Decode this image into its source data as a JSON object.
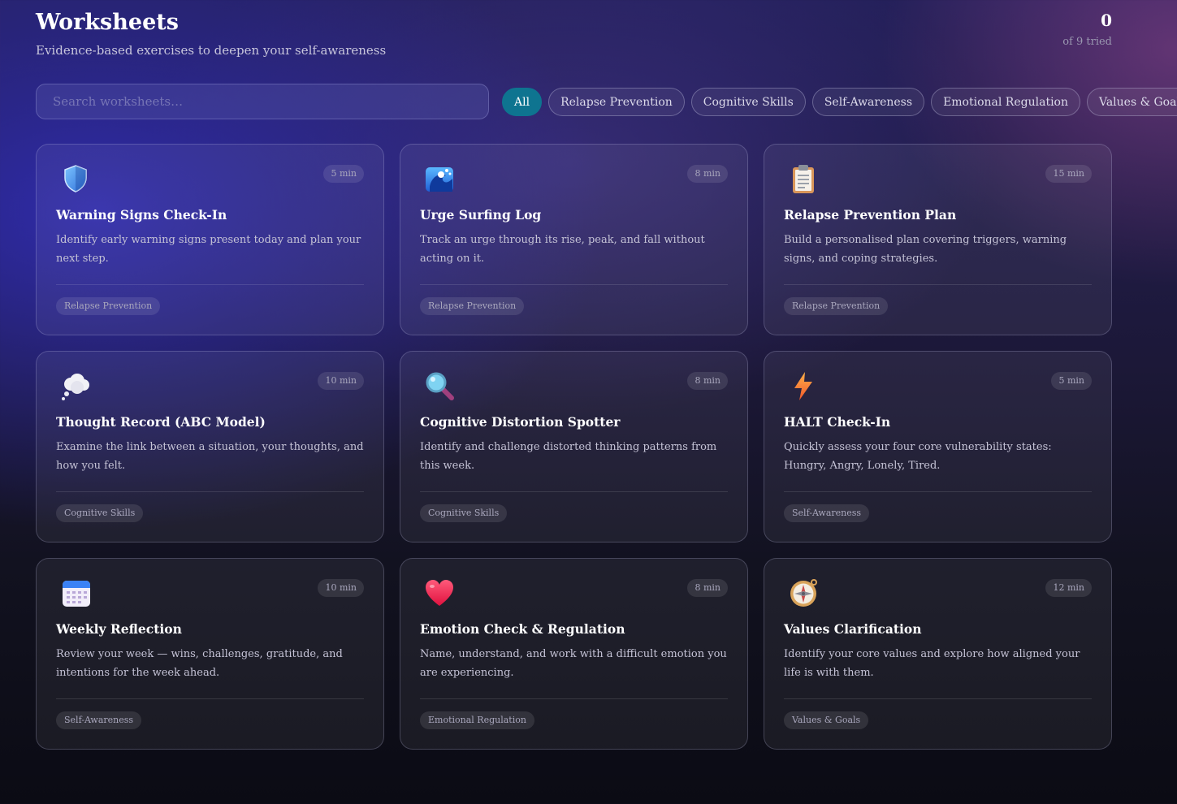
{
  "header": {
    "title": "Worksheets",
    "subtitle": "Evidence-based exercises to deepen your self-awareness",
    "count": "0",
    "count_label": "of 9 tried"
  },
  "search": {
    "placeholder": "Search worksheets…",
    "value": ""
  },
  "filters": [
    {
      "label": "All",
      "active": true
    },
    {
      "label": "Relapse Prevention",
      "active": false
    },
    {
      "label": "Cognitive Skills",
      "active": false
    },
    {
      "label": "Self-Awareness",
      "active": false
    },
    {
      "label": "Emotional Regulation",
      "active": false
    },
    {
      "label": "Values & Goals",
      "active": false
    }
  ],
  "cards": [
    {
      "icon": "shield-icon",
      "duration": "5 min",
      "title": "Warning Signs Check-In",
      "description": "Identify early warning signs present today and plan your next step.",
      "tag": "Relapse Prevention"
    },
    {
      "icon": "wave-icon",
      "duration": "8 min",
      "title": "Urge Surfing Log",
      "description": "Track an urge through its rise, peak, and fall without acting on it.",
      "tag": "Relapse Prevention"
    },
    {
      "icon": "clipboard-icon",
      "duration": "15 min",
      "title": "Relapse Prevention Plan",
      "description": "Build a personalised plan covering triggers, warning signs, and coping strategies.",
      "tag": "Relapse Prevention"
    },
    {
      "icon": "thought-bubble-icon",
      "duration": "10 min",
      "title": "Thought Record (ABC Model)",
      "description": "Examine the link between a situation, your thoughts, and how you felt.",
      "tag": "Cognitive Skills"
    },
    {
      "icon": "magnifying-glass-icon",
      "duration": "8 min",
      "title": "Cognitive Distortion Spotter",
      "description": "Identify and challenge distorted thinking patterns from this week.",
      "tag": "Cognitive Skills"
    },
    {
      "icon": "lightning-icon",
      "duration": "5 min",
      "title": "HALT Check-In",
      "description": "Quickly assess your four core vulnerability states: Hungry, Angry, Lonely, Tired.",
      "tag": "Self-Awareness"
    },
    {
      "icon": "calendar-icon",
      "duration": "10 min",
      "title": "Weekly Reflection",
      "description": "Review your week — wins, challenges, gratitude, and intentions for the week ahead.",
      "tag": "Self-Awareness"
    },
    {
      "icon": "heart-icon",
      "duration": "8 min",
      "title": "Emotion Check & Regulation",
      "description": "Name, understand, and work with a difficult emotion you are experiencing.",
      "tag": "Emotional Regulation"
    },
    {
      "icon": "compass-icon",
      "duration": "12 min",
      "title": "Values Clarification",
      "description": "Identify your core values and explore how aligned your life is with them.",
      "tag": "Values & Goals"
    }
  ],
  "colors": {
    "accent": "#0e7490"
  }
}
